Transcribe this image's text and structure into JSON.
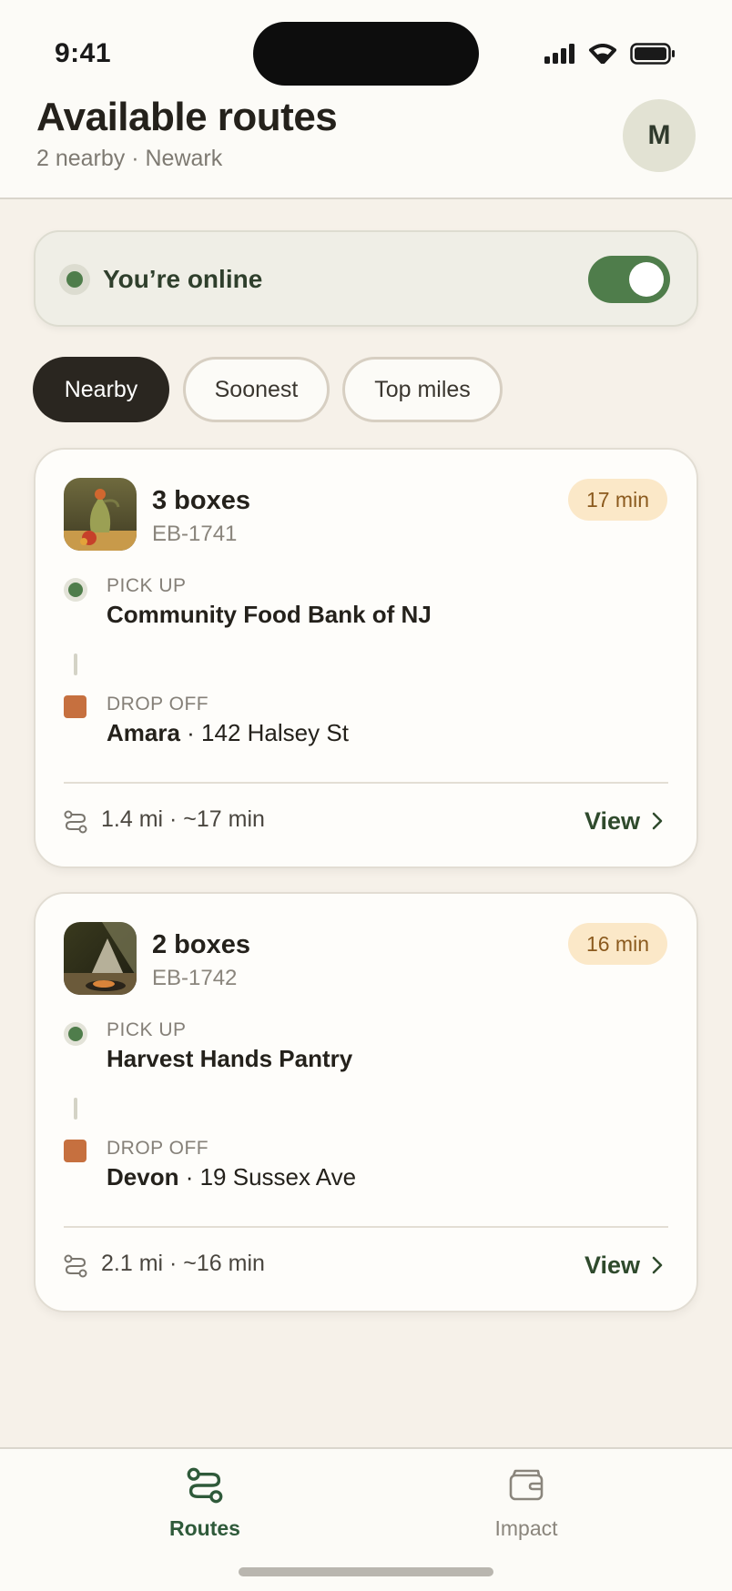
{
  "status_bar": {
    "time": "9:41"
  },
  "header": {
    "title": "Available routes",
    "subtitle": "2 nearby · Newark",
    "avatar_initial": "M"
  },
  "online": {
    "label": "You’re online",
    "toggle_on": true
  },
  "filters": [
    {
      "label": "Nearby",
      "active": true
    },
    {
      "label": "Soonest",
      "active": false
    },
    {
      "label": "Top miles",
      "active": false
    }
  ],
  "routes": [
    {
      "boxes": "3 boxes",
      "id": "EB-1741",
      "eta": "17 min",
      "pickup_label": "PICK UP",
      "pickup_name": "Community Food Bank of NJ",
      "drop_label": "DROP OFF",
      "drop_name": "Amara",
      "drop_sep": " · ",
      "drop_address": "142 Halsey St",
      "distance": "1.4 mi · ~17 min",
      "view_label": "View"
    },
    {
      "boxes": "2 boxes",
      "id": "EB-1742",
      "eta": "16 min",
      "pickup_label": "PICK UP",
      "pickup_name": "Harvest Hands Pantry",
      "drop_label": "DROP OFF",
      "drop_name": "Devon",
      "drop_sep": " · ",
      "drop_address": "19 Sussex Ave",
      "distance": "2.1 mi · ~16 min",
      "view_label": "View"
    }
  ],
  "nav": [
    {
      "label": "Routes",
      "icon": "route-icon",
      "active": true
    },
    {
      "label": "Impact",
      "icon": "wallet-icon",
      "active": false
    }
  ],
  "colors": {
    "accent_green": "#4F7D4B",
    "drop_orange": "#C6703F",
    "eta_badge_bg": "#FBE8C8",
    "background": "#F6F1E9"
  }
}
